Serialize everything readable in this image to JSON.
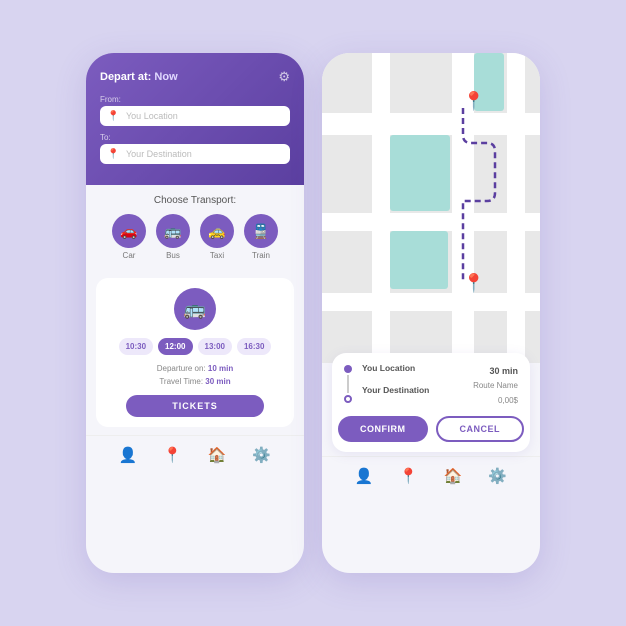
{
  "app": {
    "bg_color": "#d8d4f0",
    "accent": "#7c5cbf"
  },
  "left_phone": {
    "header": {
      "depart_label": "Depart at:",
      "depart_value": "Now",
      "from_label": "From:",
      "from_placeholder": "You Location",
      "to_label": "To:",
      "to_placeholder": "Your Destination"
    },
    "transport": {
      "title": "Choose Transport:",
      "items": [
        {
          "label": "Car",
          "icon": "🚗"
        },
        {
          "label": "Bus",
          "icon": "🚌"
        },
        {
          "label": "Taxi",
          "icon": "🚕"
        },
        {
          "label": "Train",
          "icon": "🚆"
        }
      ]
    },
    "schedule": {
      "bus_icon": "🚌",
      "time_slots": [
        "10:30",
        "12:00",
        "13:00",
        "16:30"
      ],
      "active_slot": "12:00",
      "departure_label": "Departure on:",
      "departure_value": "10 min",
      "travel_label": "Travel Time:",
      "travel_value": "30 min",
      "tickets_button": "TICKETS"
    },
    "nav_icons": [
      "👤",
      "📍",
      "🏠",
      "⚙️"
    ]
  },
  "right_phone": {
    "map": {
      "pin_top": "📍",
      "pin_bottom": "📍"
    },
    "info_card": {
      "from_location": "You Location",
      "to_destination": "Your Destination",
      "time": "30 min",
      "route_name": "Route Name",
      "price": "0,00$"
    },
    "buttons": {
      "confirm": "CONFIRM",
      "cancel": "CANCEL"
    },
    "nav_icons": [
      "👤",
      "📍",
      "🏠",
      "⚙️"
    ]
  }
}
